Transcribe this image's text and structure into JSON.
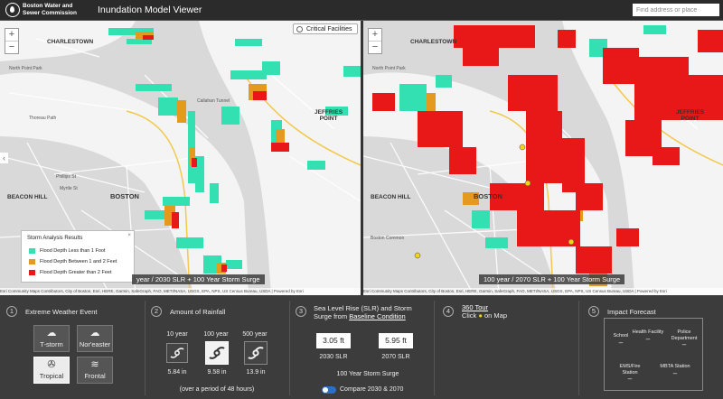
{
  "header": {
    "org_line1": "Boston Water and",
    "org_line2": "Sewer Commission",
    "app_title": "Inundation Model Viewer",
    "search_placeholder": "Find address or place"
  },
  "map_controls": {
    "zoom_in": "+",
    "zoom_out": "−",
    "critical_facilities": "Critical Facilities"
  },
  "map_labels": {
    "charlestown": "CHARLESTOWN",
    "jeffries_point_1": "JEFFRIES",
    "jeffries_point_2": "POINT",
    "boston": "BOSTON",
    "beacon_hill": "BEACON HILL",
    "north_point_park": "North Point Park",
    "thoreau_path": "Thoreau Path",
    "callahan_tunnel": "Callahan Tunnel",
    "boston_common": "Boston Common",
    "phillips_st": "Phillips St",
    "myrtle_st": "Myrtle St"
  },
  "legend": {
    "title": "Storm Analysis Results",
    "close": "×",
    "items": [
      {
        "label": "Flood Depth Less than 1 Foot",
        "color": "#33e0b2"
      },
      {
        "label": "Flood Depth Between 1 and 2 Feet",
        "color": "#e39a1e"
      },
      {
        "label": "Flood Depth Greater than 2 Feet",
        "color": "#e81818"
      }
    ]
  },
  "captions": {
    "left": "year / 2030 SLR + 100 Year Storm Surge",
    "right": "100 year / 2070 SLR + 100 Year Storm Surge"
  },
  "attribution": "Esri Community Maps Contributors, City of Boston, Esri, HERE, Garmin, SafeGraph, FAO, METI/NASA, USGS, EPA, NPS, US Census Bureau, USDA | Powered by Esri",
  "panels": {
    "weather": {
      "num": "1",
      "title": "Extreme Weather Event",
      "buttons": [
        {
          "label": "T-storm",
          "icon": "cloud-rain-icon",
          "glyph": "☁"
        },
        {
          "label": "Nor'easter",
          "icon": "wind-cloud-icon",
          "glyph": "☁"
        },
        {
          "label": "Tropical",
          "icon": "hurricane-icon",
          "glyph": "✇"
        },
        {
          "label": "Frontal",
          "icon": "wind-icon",
          "glyph": "≋"
        }
      ],
      "selected": "Tropical"
    },
    "rainfall": {
      "num": "2",
      "title": "Amount of Rainfall",
      "options": [
        {
          "period": "10 year",
          "amount": "5.84 in"
        },
        {
          "period": "100 year",
          "amount": "9.58 in"
        },
        {
          "period": "500 year",
          "amount": "13.9 in"
        }
      ],
      "selected": "100 year",
      "note": "(over a period of 48 hours)"
    },
    "slr": {
      "num": "3",
      "title_line1": "Sea Level Rise (SLR) and Storm",
      "title_line2_prefix": "Surge from ",
      "title_line2_link": "Baseline Condition",
      "options": [
        {
          "value": "3.05 ft",
          "label": "2030 SLR"
        },
        {
          "value": "5.95 ft",
          "label": "2070 SLR"
        }
      ],
      "surge_label": "100 Year Storm Surge",
      "compare_label": "Compare 2030 & 2070"
    },
    "tour": {
      "num": "4",
      "link": "360 Tour",
      "hint_prefix": "Click",
      "hint_suffix": "on Map"
    },
    "impact": {
      "num": "5",
      "title": "Impact Forecast",
      "items": [
        {
          "label": "School",
          "value": "–"
        },
        {
          "label": "Health Facility",
          "value": "–"
        },
        {
          "label": "Police Department",
          "value": "–"
        },
        {
          "label": "EMS/Fire Station",
          "value": "–"
        },
        {
          "label": "MBTA Station",
          "value": "–"
        }
      ]
    }
  }
}
